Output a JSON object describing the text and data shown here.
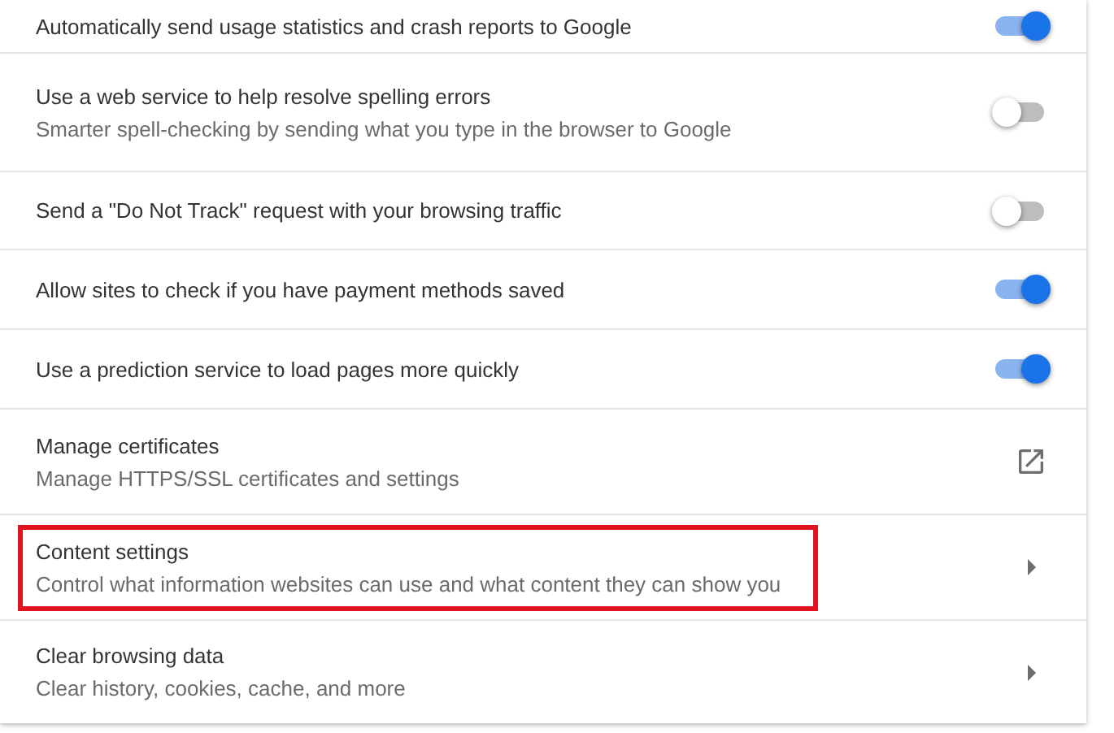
{
  "rows": [
    {
      "kind": "toggle",
      "title": "Automatically send usage statistics and crash reports to Google",
      "on": true,
      "highlighted": false
    },
    {
      "kind": "toggle",
      "title": "Use a web service to help resolve spelling errors",
      "subtitle": "Smarter spell-checking by sending what you type in the browser to Google",
      "on": false,
      "highlighted": false
    },
    {
      "kind": "toggle",
      "title": "Send a \"Do Not Track\" request with your browsing traffic",
      "on": false,
      "highlighted": false
    },
    {
      "kind": "toggle",
      "title": "Allow sites to check if you have payment methods saved",
      "on": true,
      "highlighted": false
    },
    {
      "kind": "toggle",
      "title": "Use a prediction service to load pages more quickly",
      "on": true,
      "highlighted": false
    },
    {
      "kind": "external",
      "title": "Manage certificates",
      "subtitle": "Manage HTTPS/SSL certificates and settings",
      "highlighted": false
    },
    {
      "kind": "arrow",
      "title": "Content settings",
      "subtitle": "Control what information websites can use and what content they can show you",
      "highlighted": true
    },
    {
      "kind": "arrow",
      "title": "Clear browsing data",
      "subtitle": "Clear history, cookies, cache, and more",
      "highlighted": false
    }
  ]
}
